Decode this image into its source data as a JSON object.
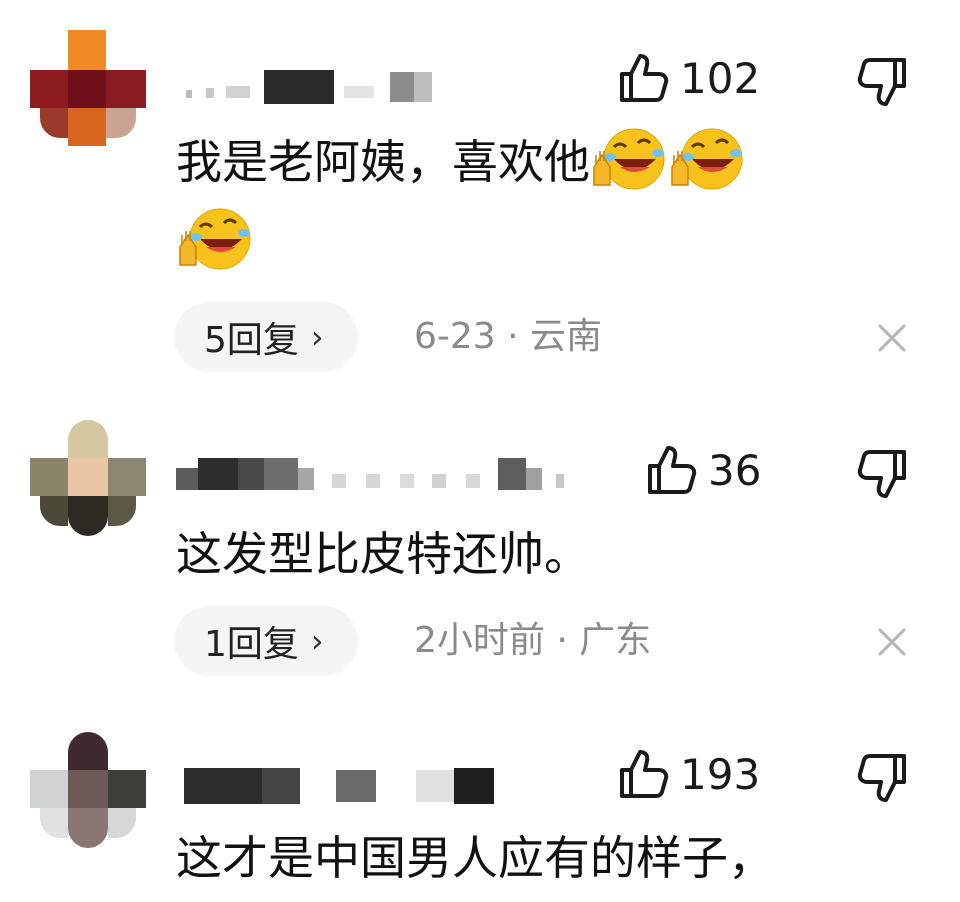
{
  "comments": [
    {
      "likes": "102",
      "text": "我是老阿姨，喜欢他",
      "emoji": [
        "laugh-cry-emoji",
        "laugh-cry-emoji",
        "laugh-cry-emoji"
      ],
      "reply_label": "5回复",
      "chevron": "›",
      "meta": "6-23 · 云南"
    },
    {
      "likes": "36",
      "text": "这发型比皮特还帅。",
      "reply_label": "1回复",
      "chevron": "›",
      "meta": "2小时前 · 广东"
    },
    {
      "likes": "193",
      "text": "这才是中国男人应有的样子，"
    }
  ],
  "icons": {
    "like": "thumbs-up-icon",
    "dislike": "thumbs-down-icon",
    "close": "close-icon"
  },
  "colors": {
    "text": "#111111",
    "meta": "#8a8a8a",
    "pill_bg": "#f5f5f5",
    "emoji_yellow": "#f8c21c"
  }
}
